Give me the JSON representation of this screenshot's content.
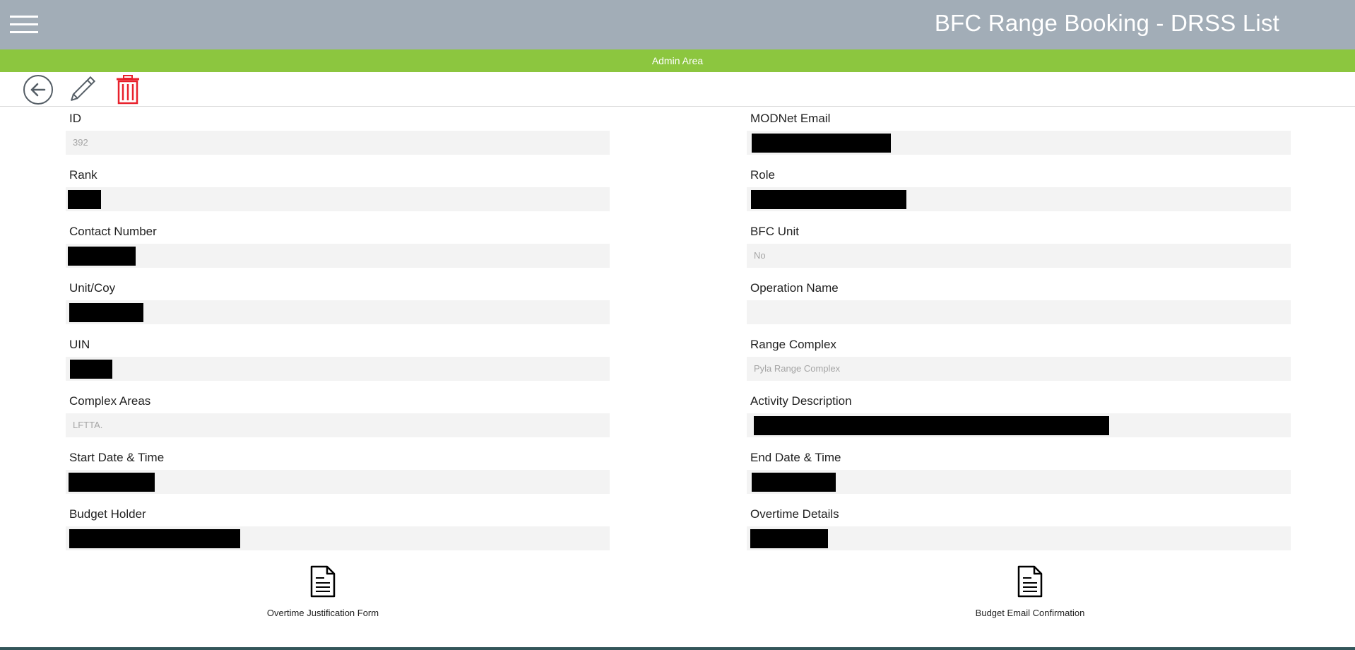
{
  "header": {
    "title": "BFC Range Booking - DRSS List",
    "menu_icon": "hamburger-menu-icon"
  },
  "admin_bar": {
    "label": "Admin Area"
  },
  "toolbar": {
    "back_icon": "back-arrow-icon",
    "edit_icon": "pencil-icon",
    "delete_icon": "trash-icon",
    "delete_color": "#e8212c"
  },
  "fields_left": [
    {
      "label": "ID",
      "value": "392"
    },
    {
      "label": "Rank",
      "value": ""
    },
    {
      "label": "Contact Number",
      "value": ""
    },
    {
      "label": "Unit/Coy",
      "value": ""
    },
    {
      "label": "UIN",
      "value": ""
    },
    {
      "label": "Complex Areas",
      "value": "LFTTA."
    },
    {
      "label": "Start Date & Time",
      "value": ""
    },
    {
      "label": "Budget Holder",
      "value": ""
    }
  ],
  "fields_right": [
    {
      "label": "MODNet Email",
      "value": ""
    },
    {
      "label": "Role",
      "value": ""
    },
    {
      "label": "BFC Unit",
      "value": "No"
    },
    {
      "label": "Operation Name",
      "value": ""
    },
    {
      "label": "Range Complex",
      "value": "Pyla Range Complex"
    },
    {
      "label": "Activity Description",
      "value": ""
    },
    {
      "label": "End Date & Time",
      "value": ""
    },
    {
      "label": "Overtime Details",
      "value": ""
    }
  ],
  "attachments": [
    {
      "label": "Overtime Justification Form",
      "icon": "document-icon"
    },
    {
      "label": "Budget Email Confirmation",
      "icon": "document-icon"
    }
  ],
  "colors": {
    "header_bg": "#a2adb7",
    "admin_bar_bg": "#8cc63f",
    "field_bg": "#f3f3f3"
  }
}
